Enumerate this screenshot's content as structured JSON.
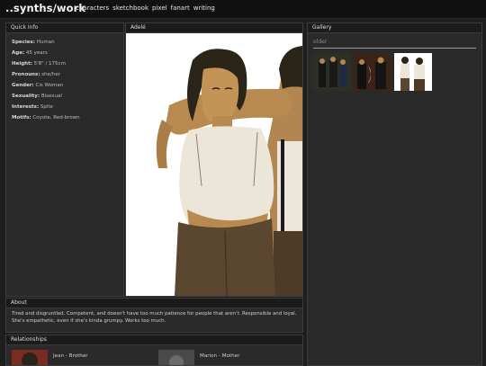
{
  "site": {
    "brand": "..synths/work",
    "nav": [
      "characters",
      "sketchbook",
      "pixel",
      "fanart",
      "writing"
    ]
  },
  "quick_info": {
    "title": "Quick Info",
    "rows": [
      {
        "key": "Species:",
        "value": "Human"
      },
      {
        "key": "Age:",
        "value": "45 years"
      },
      {
        "key": "Height:",
        "value": "5'8\" / 175cm"
      },
      {
        "key": "Pronouns:",
        "value": "she/her"
      },
      {
        "key": "Gender:",
        "value": "Cis Woman"
      },
      {
        "key": "Sexuality:",
        "value": "Bisexual"
      },
      {
        "key": "Interests:",
        "value": "Spite"
      },
      {
        "key": "Motifs:",
        "value": "Coyote, Red-brown"
      }
    ]
  },
  "character": {
    "name": "Adelé"
  },
  "gallery": {
    "title": "Gallery",
    "subtitle": "older"
  },
  "about": {
    "title": "About",
    "text": "Tired and disgruntled. Competent, and doesn't have too much patience for people that aren't. Responsible and loyal. She's empathetic, even if she's kinda grumpy. Works too much."
  },
  "relationships": {
    "title": "Relationships",
    "items": [
      {
        "name": "Jean - Brother"
      },
      {
        "name": "Marion - Mother"
      }
    ]
  },
  "colors": {
    "background": "#1e1e1e",
    "panel": "#2a2a2a",
    "panel_header": "#1b1b1b",
    "skin": "#b88a4f",
    "shirt": "#ebe6d8",
    "pants": "#5b4630",
    "hair": "#2b2419"
  }
}
